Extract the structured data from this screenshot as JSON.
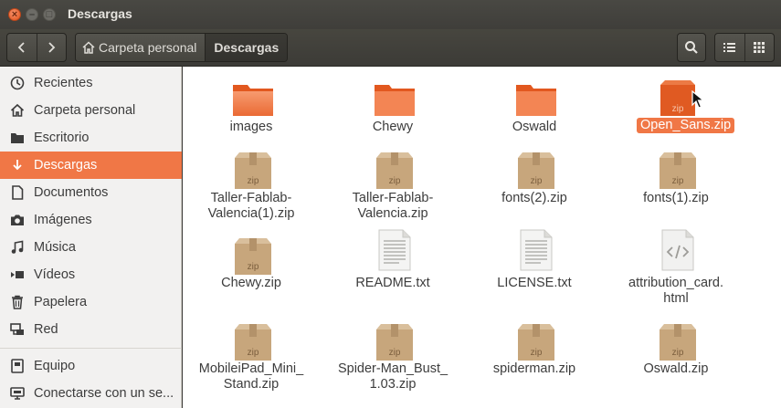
{
  "window": {
    "title": "Descargas"
  },
  "toolbar": {
    "back_icon": "chevron-left-icon",
    "forward_icon": "chevron-right-icon",
    "breadcrumbs": [
      {
        "label": "Carpeta personal",
        "icon": "home-icon"
      },
      {
        "label": "Descargas"
      }
    ],
    "search_icon": "search-icon",
    "list_view_icon": "list-view-icon",
    "grid_view_icon": "grid-view-icon"
  },
  "sidebar": {
    "items": [
      {
        "label": "Recientes",
        "icon": "clock-icon"
      },
      {
        "label": "Carpeta personal",
        "icon": "home-icon"
      },
      {
        "label": "Escritorio",
        "icon": "folder-icon"
      },
      {
        "label": "Descargas",
        "icon": "download-icon",
        "selected": true
      },
      {
        "label": "Documentos",
        "icon": "document-icon"
      },
      {
        "label": "Imágenes",
        "icon": "camera-icon"
      },
      {
        "label": "Música",
        "icon": "music-icon"
      },
      {
        "label": "Vídeos",
        "icon": "video-icon"
      },
      {
        "label": "Papelera",
        "icon": "trash-icon"
      },
      {
        "label": "Red",
        "icon": "network-icon"
      },
      {
        "label": "Equipo",
        "icon": "computer-icon"
      },
      {
        "label": "Conectarse con un se...",
        "icon": "server-icon"
      }
    ]
  },
  "files": [
    {
      "name": "images",
      "type": "folder"
    },
    {
      "name": "Chewy",
      "type": "folder"
    },
    {
      "name": "Oswald",
      "type": "folder"
    },
    {
      "name": "Open_Sans.zip",
      "type": "zip",
      "selected": true
    },
    {
      "name": "Taller-Fablab-\nValencia(1).zip",
      "type": "zip"
    },
    {
      "name": "Taller-Fablab-\nValencia.zip",
      "type": "zip"
    },
    {
      "name": "fonts(2).zip",
      "type": "zip"
    },
    {
      "name": "fonts(1).zip",
      "type": "zip"
    },
    {
      "name": "Chewy.zip",
      "type": "zip"
    },
    {
      "name": "README.txt",
      "type": "text"
    },
    {
      "name": "LICENSE.txt",
      "type": "text"
    },
    {
      "name": "attribution_card.\nhtml",
      "type": "html"
    },
    {
      "name": "MobileiPad_Mini_\nStand.zip",
      "type": "zip"
    },
    {
      "name": "Spider-Man_Bust_\n1.03.zip",
      "type": "zip"
    },
    {
      "name": "spiderman.zip",
      "type": "zip"
    },
    {
      "name": "Oswald.zip",
      "type": "zip"
    }
  ],
  "colors": {
    "accent": "#f07746",
    "titlebar": "#3c3b37",
    "sidebar": "#f2f1f0"
  }
}
